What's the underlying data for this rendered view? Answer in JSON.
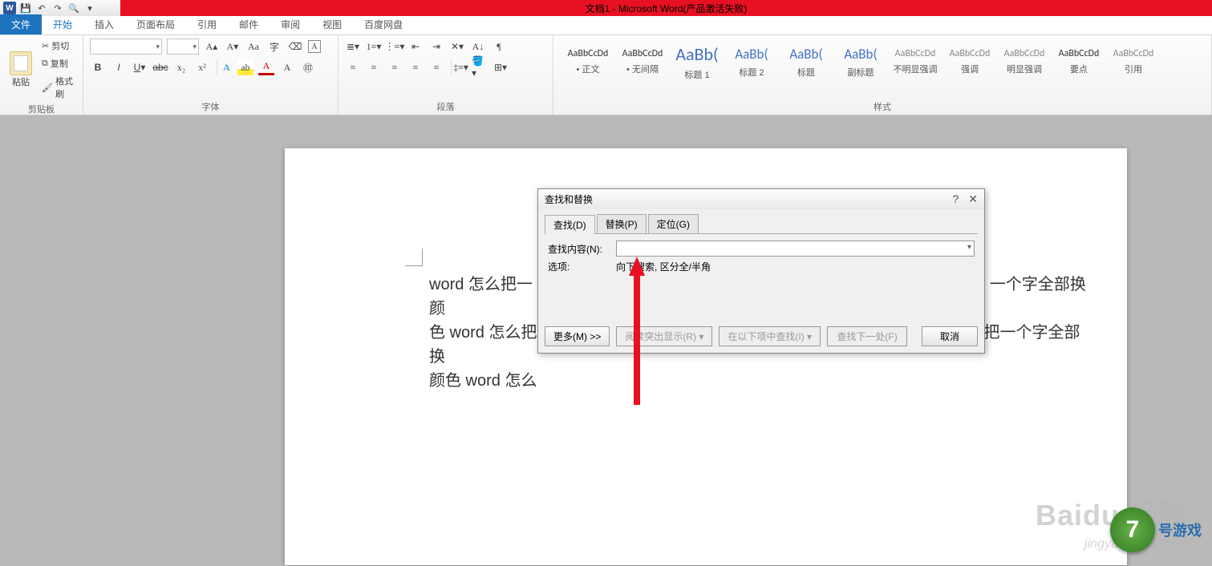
{
  "titlebar": {
    "title": "文档1 - Microsoft Word(产品激活失败)"
  },
  "tabs": {
    "file": "文件",
    "items": [
      "开始",
      "插入",
      "页面布局",
      "引用",
      "邮件",
      "审阅",
      "视图",
      "百度网盘"
    ],
    "active": "开始"
  },
  "ribbon": {
    "clipboard": {
      "paste": "粘贴",
      "cut": "剪切",
      "copy": "复制",
      "format_painter": "格式刷",
      "group_label": "剪贴板"
    },
    "font": {
      "group_label": "字体"
    },
    "paragraph": {
      "group_label": "段落"
    },
    "styles": {
      "group_label": "样式",
      "items": [
        {
          "preview": "AaBbCcDd",
          "name": "• 正文",
          "cls": ""
        },
        {
          "preview": "AaBbCcDd",
          "name": "• 无间隔",
          "cls": ""
        },
        {
          "preview": "AaBb(",
          "name": "标题 1",
          "cls": "h",
          "big": true
        },
        {
          "preview": "AaBb(",
          "name": "标题 2",
          "cls": "h"
        },
        {
          "preview": "AaBb(",
          "name": "标题",
          "cls": "h"
        },
        {
          "preview": "AaBb(",
          "name": "副标题",
          "cls": "h"
        },
        {
          "preview": "AaBbCcDd",
          "name": "不明显强调",
          "cls": "sub"
        },
        {
          "preview": "AaBbCcDd",
          "name": "强调",
          "cls": "sub"
        },
        {
          "preview": "AaBbCcDd",
          "name": "明显强调",
          "cls": "sub"
        },
        {
          "preview": "AaBbCcDd",
          "name": "要点",
          "cls": ""
        },
        {
          "preview": "AaBbCcDd",
          "name": "引用",
          "cls": "sub"
        }
      ]
    }
  },
  "document": {
    "line1": "word 怎么把一",
    "line1b": "一个字全部换颜",
    "line2": "色 word 怎么把",
    "line2b": "把一个字全部换",
    "line3": "颜色 word 怎么"
  },
  "dialog": {
    "title": "查找和替换",
    "tabs": {
      "find": "查找(D)",
      "replace": "替换(P)",
      "goto": "定位(G)"
    },
    "find_label": "查找内容(N):",
    "options_label": "选项:",
    "options_value": "向下搜索, 区分全/半角",
    "buttons": {
      "more": "更多(M) >>",
      "reading": "阅读突出显示(R) ▾",
      "findin": "在以下项中查找(I) ▾",
      "findnext": "查找下一处(F)",
      "cancel": "取消"
    }
  },
  "watermark": {
    "brand": "Baidu 经验",
    "url": "jingyan.baidu.com",
    "badge_num": "7",
    "badge_txt": "号游戏"
  }
}
